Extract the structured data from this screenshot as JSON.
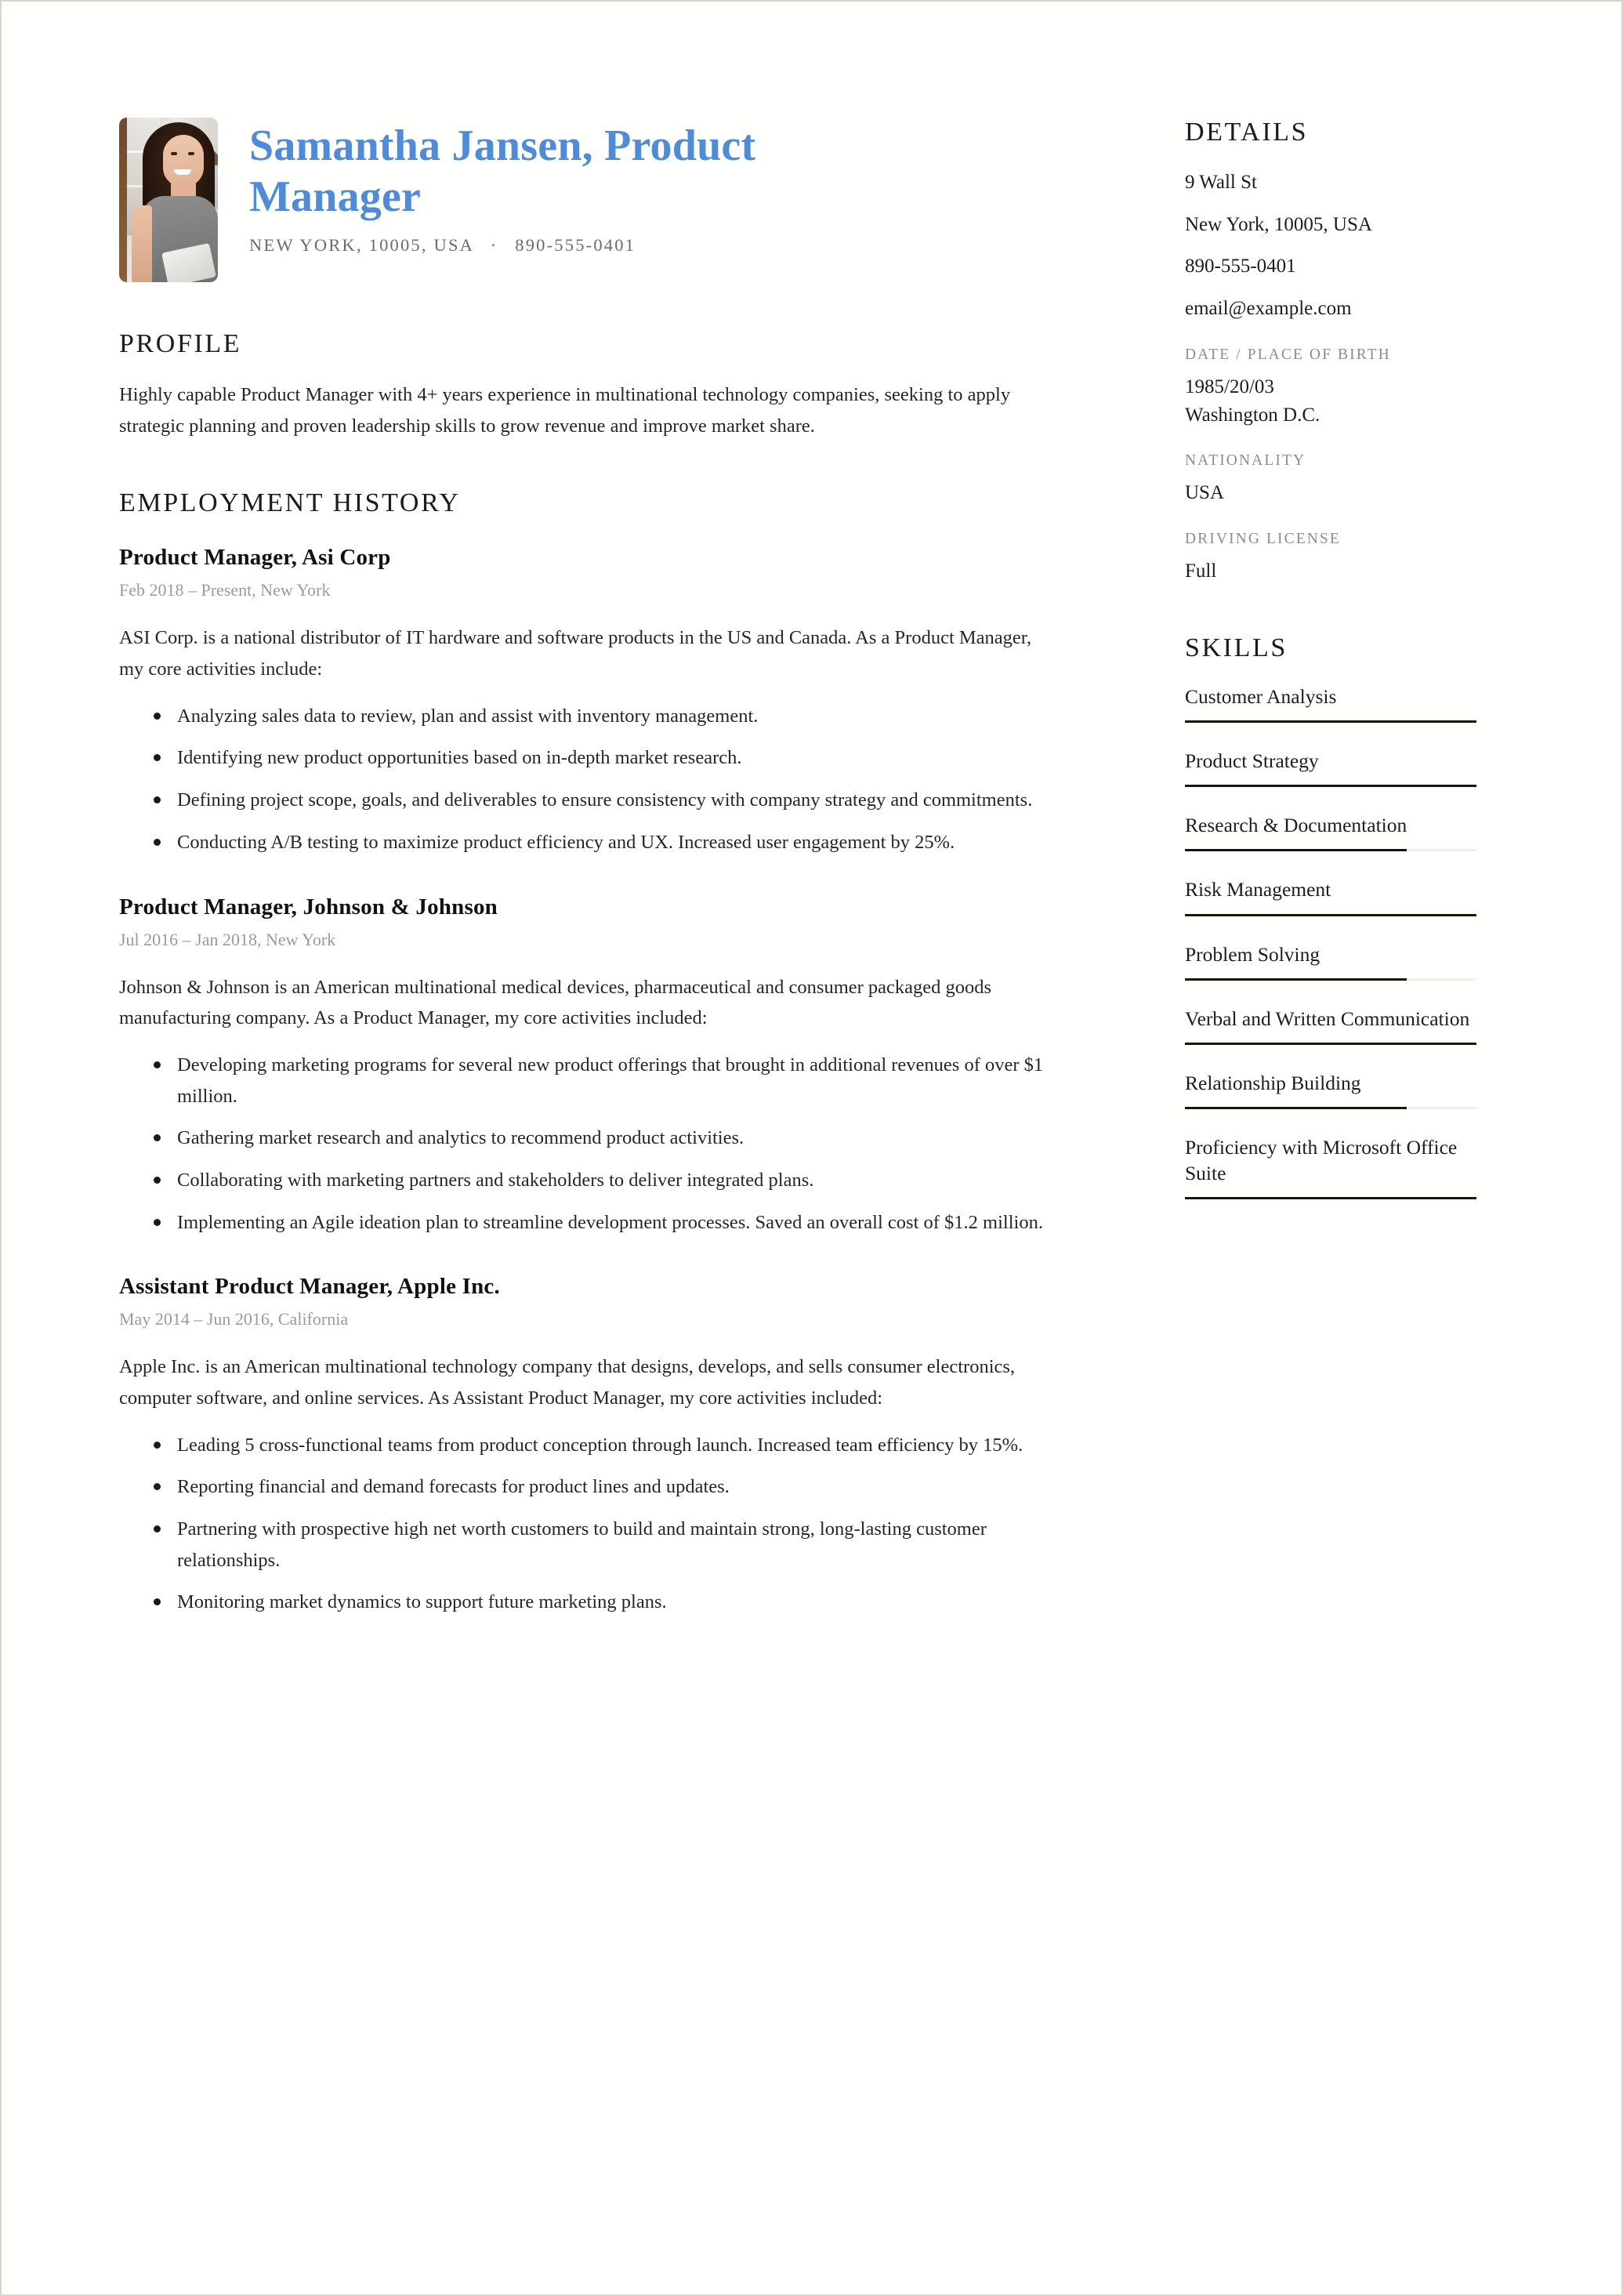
{
  "header": {
    "name": "Samantha Jansen, Product Manager",
    "location": "NEW YORK, 10005, USA",
    "separator": "·",
    "phone": "890-555-0401",
    "photo_alt": "portrait-photo"
  },
  "profile": {
    "title": "PROFILE",
    "text": "Highly capable Product Manager with 4+ years experience in multinational technology companies, seeking to apply strategic planning and proven leadership skills to grow revenue and improve market share."
  },
  "employment": {
    "title": "EMPLOYMENT HISTORY",
    "jobs": [
      {
        "title": "Product Manager, Asi Corp",
        "meta": "Feb 2018 – Present, New York",
        "description": "ASI Corp. is a national distributor of IT hardware and software products in the US and Canada. As a Product Manager, my core activities include:",
        "bullets": [
          "Analyzing sales data to review, plan and assist with inventory management.",
          "Identifying new product opportunities based on in-depth market research.",
          "Defining project scope, goals, and deliverables to ensure consistency with company strategy and commitments.",
          "Conducting A/B testing to maximize product efficiency and UX. Increased user engagement by 25%."
        ]
      },
      {
        "title": "Product Manager, Johnson & Johnson",
        "meta": "Jul 2016 – Jan 2018, New York",
        "description": "Johnson & Johnson is an American multinational medical devices, pharmaceutical and consumer packaged goods manufacturing company. As a Product Manager, my core activities included:",
        "bullets": [
          "Developing marketing programs for several new product offerings that brought in additional revenues of over $1 million.",
          "Gathering market research and analytics to recommend product activities.",
          "Collaborating with marketing partners and stakeholders to deliver integrated plans.",
          "Implementing an Agile ideation plan to streamline development processes. Saved an overall cost of $1.2 million."
        ]
      },
      {
        "title": "Assistant Product Manager, Apple Inc.",
        "meta": "May 2014 – Jun 2016, California",
        "description": "Apple Inc. is an American multinational technology company that designs, develops, and sells consumer electronics, computer software, and online services. As Assistant Product Manager, my core activities included:",
        "bullets": [
          "Leading 5 cross-functional teams from product conception through launch. Increased team efficiency by 15%.",
          "Reporting financial and demand forecasts for product lines and updates.",
          "Partnering with prospective high net worth customers to build and maintain strong, long-lasting customer relationships.",
          "Monitoring market dynamics to support future marketing plans."
        ]
      }
    ]
  },
  "details": {
    "title": "DETAILS",
    "address_line1": "9 Wall St",
    "address_line2": "New York, 10005, USA",
    "phone": "890-555-0401",
    "email": "email@example.com",
    "dob_label": "DATE / PLACE OF BIRTH",
    "dob_date": "1985/20/03",
    "dob_place": "Washington D.C.",
    "nationality_label": "NATIONALITY",
    "nationality_value": "USA",
    "license_label": "DRIVING LICENSE",
    "license_value": "Full"
  },
  "skills": {
    "title": "SKILLS",
    "items": [
      {
        "name": "Customer Analysis",
        "level": 100
      },
      {
        "name": "Product Strategy",
        "level": 100
      },
      {
        "name": "Research & Documentation",
        "level": 76
      },
      {
        "name": "Risk Management",
        "level": 100
      },
      {
        "name": "Problem Solving",
        "level": 76
      },
      {
        "name": "Verbal and Written Communication",
        "level": 100
      },
      {
        "name": "Relationship Building",
        "level": 76
      },
      {
        "name": "Proficiency with Microsoft Office Suite",
        "level": 100
      }
    ]
  },
  "theme": {
    "accent": "#4f8bd6",
    "text": "#262626",
    "muted": "#9a9a9a",
    "label": "#8c8c8c",
    "rule": "#16160f",
    "page_border": "#d8d6c8"
  }
}
